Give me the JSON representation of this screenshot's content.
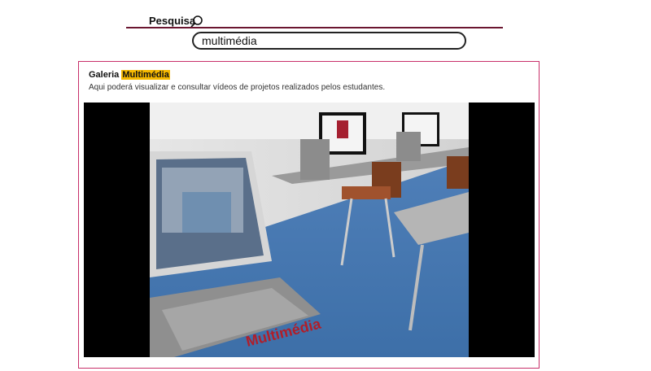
{
  "search": {
    "label": "Pesquisa",
    "value": "multimédia",
    "icon": "magnifier-icon"
  },
  "gallery": {
    "title_prefix": "Galeria",
    "title_highlight": "Multimédia",
    "description": "Aqui poderá visualizar e consultar vídeos de projetos realizados pelos estudantes.",
    "video": {
      "overlay_text": "Multimédia"
    }
  },
  "colors": {
    "rule": "#6b1630",
    "panel_border": "#c8306a",
    "highlight": "#f5b800"
  }
}
